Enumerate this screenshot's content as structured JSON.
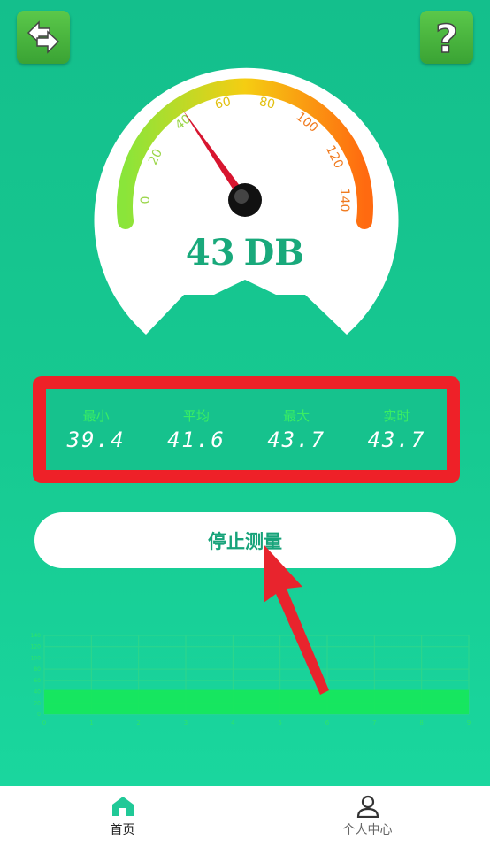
{
  "header": {
    "left_icon": "refresh-arrows-icon",
    "right_icon": "help-question-icon"
  },
  "gauge": {
    "min": 0,
    "max": 140,
    "value": 43,
    "ticks": [
      "0",
      "20",
      "40",
      "60",
      "80",
      "100",
      "120",
      "140"
    ],
    "reading_value": "43",
    "reading_unit": "DB",
    "colors": {
      "low": "#8ae53a",
      "mid": "#f5cd12",
      "high": "#ff6a10",
      "needle": "#d7152f"
    }
  },
  "stats": [
    {
      "label": "最小",
      "value": "39.4"
    },
    {
      "label": "平均",
      "value": "41.6"
    },
    {
      "label": "最大",
      "value": "43.7"
    },
    {
      "label": "实时",
      "value": "43.7"
    }
  ],
  "stop_button": {
    "label": "停止测量"
  },
  "chart_data": {
    "type": "area",
    "x": [
      0,
      1,
      2,
      3,
      4,
      5,
      6,
      7,
      8,
      9
    ],
    "values": [
      43,
      43,
      43,
      43,
      43,
      43,
      43,
      43,
      43,
      43
    ],
    "ylim": [
      0,
      140
    ],
    "y_ticks": [
      0,
      20,
      40,
      60,
      80,
      100,
      120,
      140
    ],
    "grid": true,
    "color": "#16e85a"
  },
  "nav": {
    "items": [
      {
        "label": "首页",
        "icon": "home-icon",
        "active": true
      },
      {
        "label": "个人中心",
        "icon": "user-icon",
        "active": false
      }
    ]
  }
}
